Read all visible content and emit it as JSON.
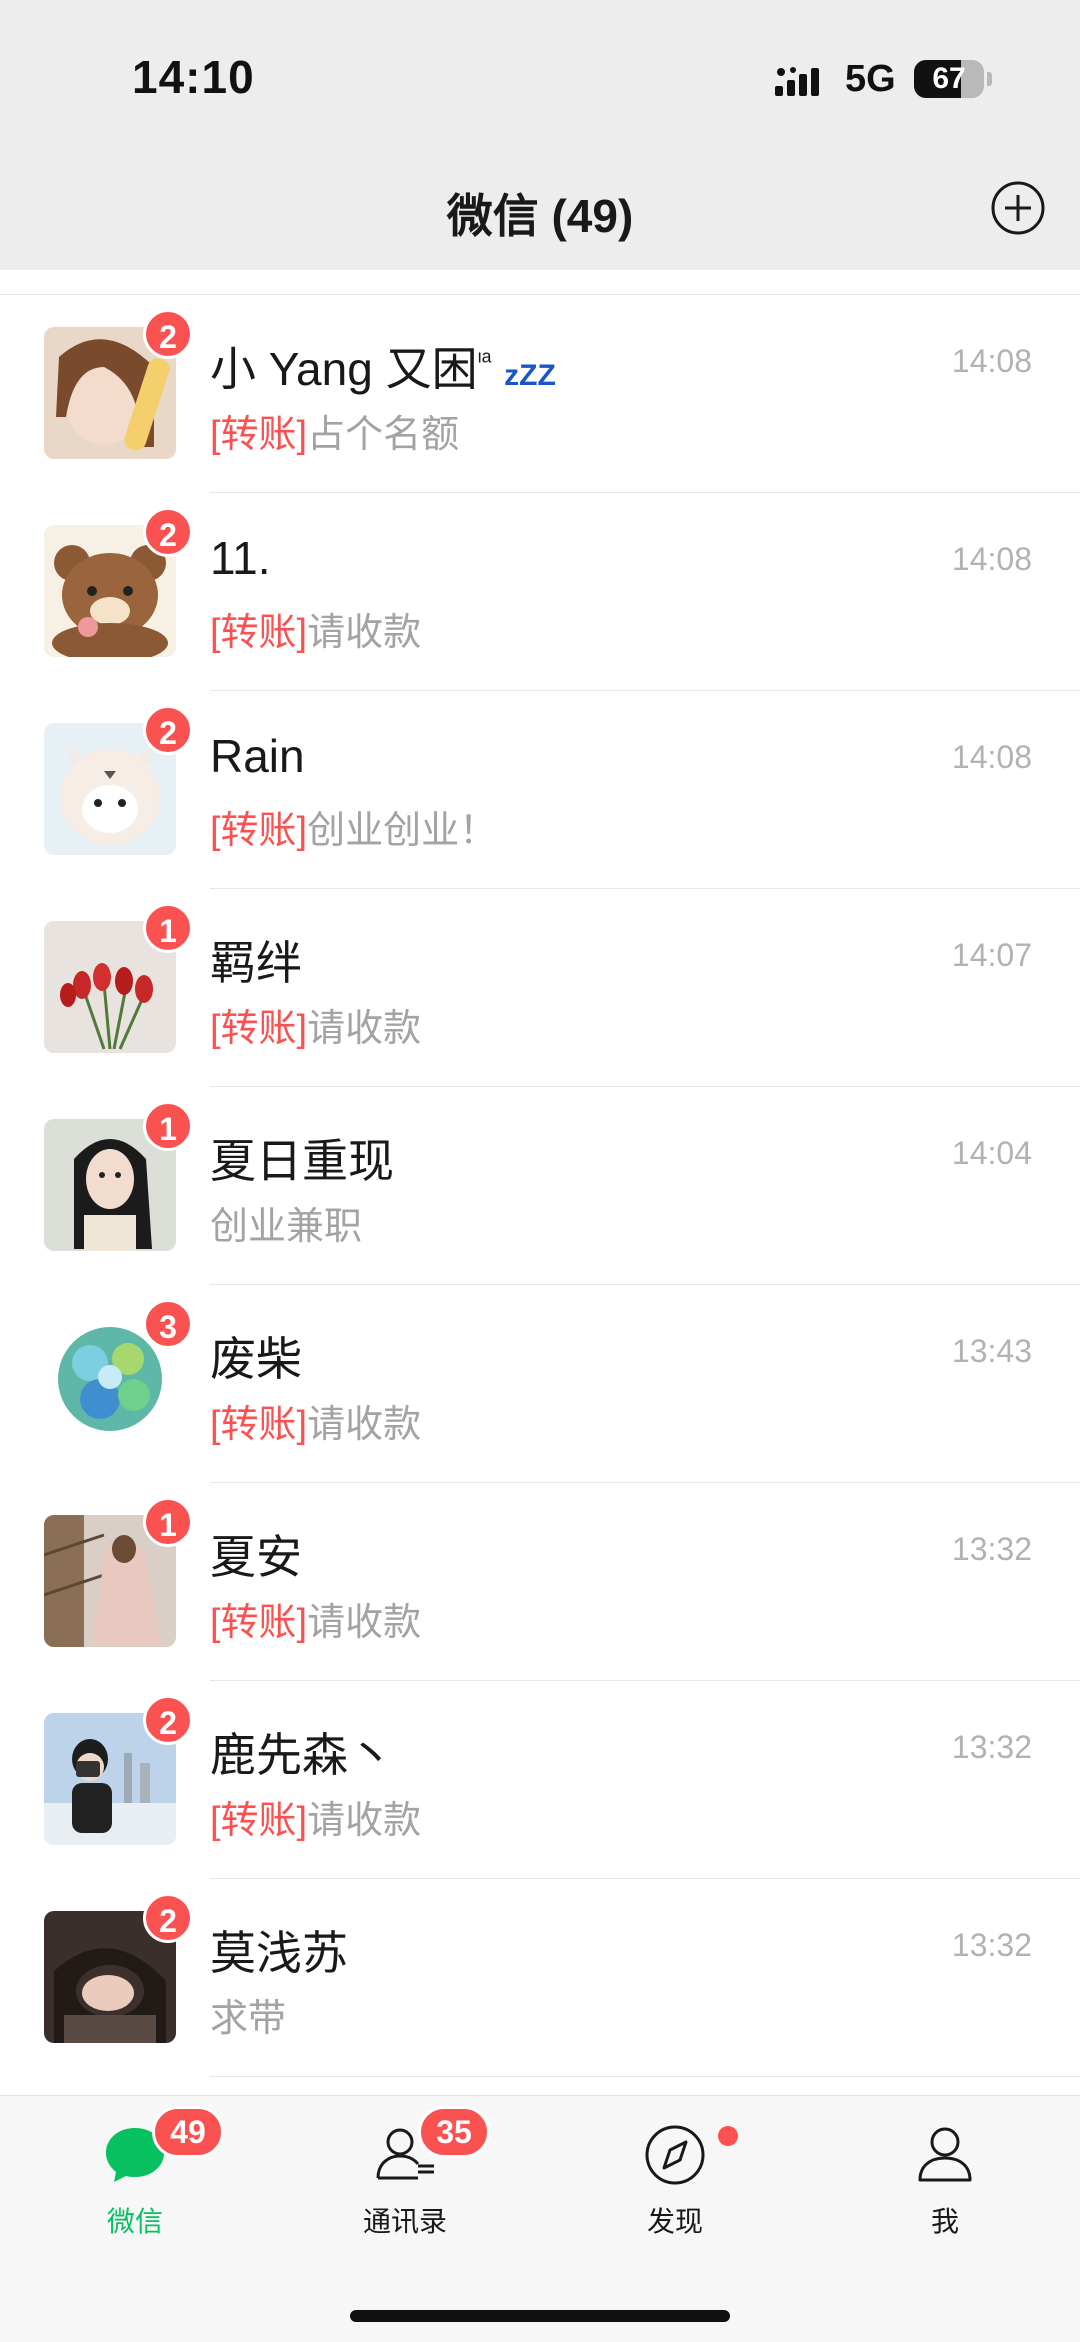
{
  "status_bar": {
    "time": "14:10",
    "network": "5G",
    "battery": "67",
    "battery_level": 0.67
  },
  "nav": {
    "title": "微信 (49)",
    "add_icon": "plus-circle-icon"
  },
  "chats": [
    {
      "name": "小 Yang 又困",
      "name_suffix": "ᶦᵃ",
      "zzz": "zZZ",
      "unread": "2",
      "time": "14:08",
      "tag": "[转账]",
      "preview": "占个名额",
      "avatar": "girl-with-bread"
    },
    {
      "name": "11.",
      "unread": "2",
      "time": "14:08",
      "tag": "[转账]",
      "preview": "请收款",
      "avatar": "brown-bear"
    },
    {
      "name": "Rain",
      "unread": "2",
      "time": "14:08",
      "tag": "[转账]",
      "preview": "创业创业！",
      "avatar": "cat-plush"
    },
    {
      "name": "羁绊",
      "unread": "1",
      "time": "14:07",
      "tag": "[转账]",
      "preview": "请收款",
      "avatar": "red-tulips"
    },
    {
      "name": "夏日重现",
      "unread": "1",
      "time": "14:04",
      "tag": "",
      "preview": "创业兼职",
      "avatar": "girl-portrait"
    },
    {
      "name": "废柴",
      "unread": "3",
      "time": "13:43",
      "tag": "[转账]",
      "preview": "请收款",
      "avatar": "blue-hydrangea"
    },
    {
      "name": "夏安",
      "unread": "1",
      "time": "13:32",
      "tag": "[转账]",
      "preview": "请收款",
      "avatar": "girl-on-stairs"
    },
    {
      "name": "鹿先森丶",
      "unread": "2",
      "time": "13:32",
      "tag": "[转账]",
      "preview": "请收款",
      "avatar": "boy-with-camera"
    },
    {
      "name": "莫浅苏",
      "unread": "2",
      "time": "13:32",
      "tag": "",
      "preview": "求带",
      "avatar": "girl-lying-down"
    }
  ],
  "tabs": [
    {
      "label": "微信",
      "badge": "49",
      "icon": "chat-bubble-icon",
      "active": true
    },
    {
      "label": "通讯录",
      "badge": "35",
      "icon": "contacts-icon",
      "active": false
    },
    {
      "label": "发现",
      "badge": "",
      "icon": "compass-icon",
      "active": false,
      "dot": true
    },
    {
      "label": "我",
      "badge": "",
      "icon": "person-icon",
      "active": false
    }
  ],
  "colors": {
    "accent_green": "#07c160",
    "badge_red": "#fa5151",
    "tag_red": "#fa5151",
    "bar_gray": "#ededed"
  }
}
